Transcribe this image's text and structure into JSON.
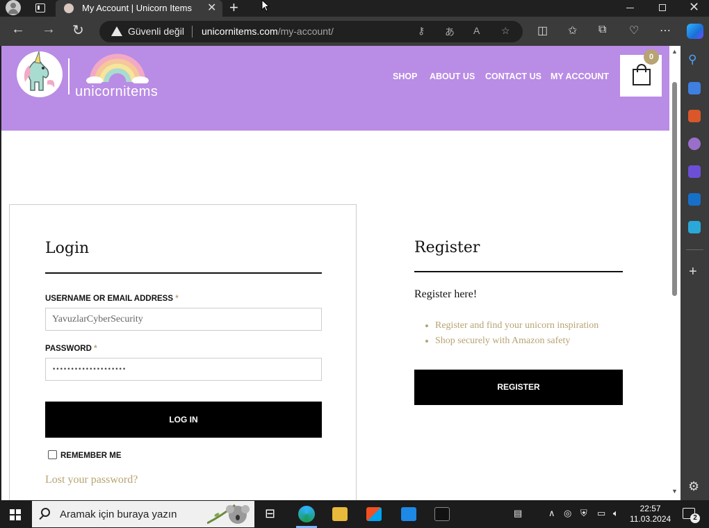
{
  "browser": {
    "tab": {
      "title": "My Account | Unicorn Items",
      "close": "✕"
    },
    "new_tab": "+",
    "security_label": "Güvenli değil",
    "url_domain": "unicornitems.com",
    "url_path": "/my-account/"
  },
  "site": {
    "logo_text": "unicornitems",
    "menu": [
      {
        "label": "SHOP"
      },
      {
        "label": "ABOUT US"
      },
      {
        "label": "CONTACT US"
      },
      {
        "label": "MY ACCOUNT"
      }
    ],
    "cart_count": "0",
    "brand_color": "#b98ce5",
    "accent_color": "#b7a373"
  },
  "login": {
    "heading": "Login",
    "username_label": "USERNAME OR EMAIL ADDRESS",
    "required_mark": "*",
    "username_value": "YavuzlarCyberSecurity",
    "password_label": "PASSWORD",
    "password_value": "••••••••••••••••••••",
    "submit_label": "LOG IN",
    "remember_label": "REMEMBER ME",
    "lost_password": "Lost your password?"
  },
  "register": {
    "heading": "Register",
    "intro": "Register here!",
    "bullets": [
      "Register and find your unicorn inspiration",
      "Shop securely with Amazon safety"
    ],
    "button_label": "REGISTER"
  },
  "taskbar": {
    "search_placeholder": "Aramak için buraya yazın",
    "time": "22:57",
    "date": "11.03.2024",
    "notification_count": "2"
  }
}
